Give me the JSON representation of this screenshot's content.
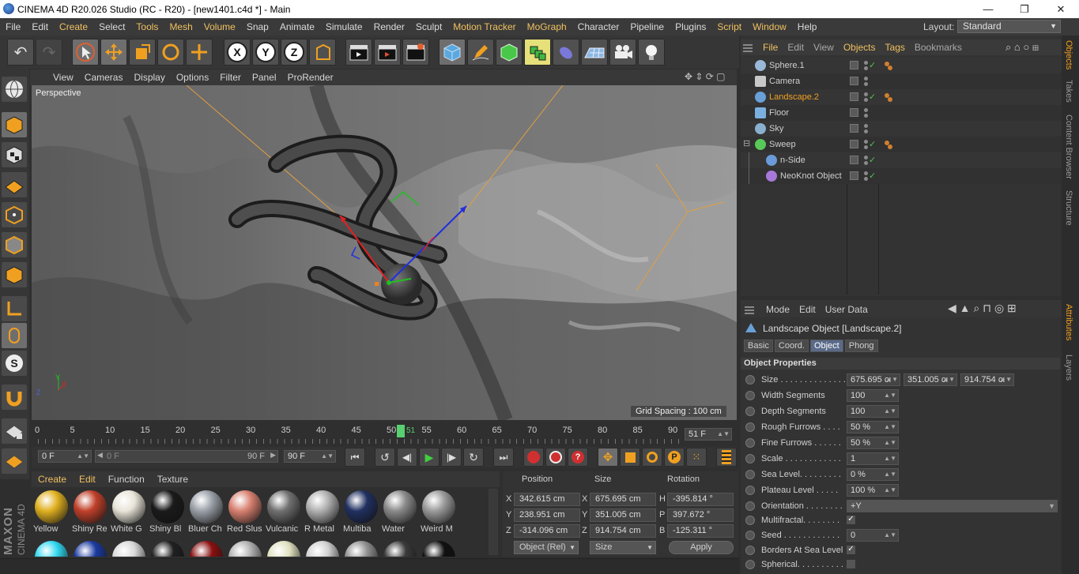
{
  "window": {
    "title": "CINEMA 4D R20.026 Studio (RC - R20) - [new1401.c4d *] - Main",
    "minimize": "—",
    "maximize": "❐",
    "close": "✕"
  },
  "menu": {
    "items": [
      "File",
      "Edit",
      "Create",
      "Select",
      "Tools",
      "Mesh",
      "Volume",
      "Snap",
      "Animate",
      "Simulate",
      "Render",
      "Sculpt",
      "Motion Tracker",
      "MoGraph",
      "Character",
      "Pipeline",
      "Plugins",
      "Script",
      "Window",
      "Help"
    ],
    "layout_label": "Layout:",
    "layout_value": "Standard"
  },
  "toolbar": {
    "axis_x": "X",
    "axis_y": "Y",
    "axis_z": "Z"
  },
  "viewport": {
    "menu": [
      "View",
      "Cameras",
      "Display",
      "Options",
      "Filter",
      "Panel",
      "ProRender"
    ],
    "camera_label": "Perspective",
    "grid_spacing": "Grid Spacing : 100 cm",
    "axis_x": "X",
    "axis_y": "Y",
    "axis_z": "Z"
  },
  "timeline": {
    "ticks": [
      "0",
      "5",
      "10",
      "15",
      "20",
      "25",
      "30",
      "35",
      "40",
      "45",
      "50",
      "55",
      "60",
      "65",
      "70",
      "75",
      "80",
      "85",
      "90"
    ],
    "current_frame_marker": "51",
    "current_frame_field": "51 F",
    "start_field": "0 F",
    "range_start": "0 F",
    "range_end": "90 F",
    "end_field": "90 F"
  },
  "materials": {
    "menu": [
      "Create",
      "Edit",
      "Function",
      "Texture"
    ],
    "row1": [
      {
        "name": "Yellow",
        "color": "#e0b020"
      },
      {
        "name": "Shiny Re",
        "color": "#c0402a"
      },
      {
        "name": "White G",
        "color": "#e8e4d8"
      },
      {
        "name": "Shiny Bl",
        "color": "#1a1a1a"
      },
      {
        "name": "Bluer Ch",
        "color": "#9aa0a8"
      },
      {
        "name": "Red Slus",
        "color": "#d88070"
      },
      {
        "name": "Vulcanic",
        "color": "#707070"
      },
      {
        "name": "R Metal",
        "color": "#b0b0b0"
      },
      {
        "name": "Multiba",
        "color": "#203060"
      },
      {
        "name": "Water",
        "color": "#8a8a8a"
      },
      {
        "name": "Weird M",
        "color": "#9a9a9a"
      }
    ],
    "row2_colors": [
      "#30d8f0",
      "#1a3aa0",
      "#d8d8d8",
      "#202020",
      "#8a1010",
      "#b0b0b0",
      "#e0e0c0",
      "#d0d0d0",
      "#909090",
      "#3a3a3a",
      "#101010"
    ]
  },
  "coords": {
    "headers": {
      "position": "Position",
      "size": "Size",
      "rotation": "Rotation"
    },
    "rows": [
      {
        "pl": "X",
        "pv": "342.615 cm",
        "sl": "X",
        "sv": "675.695 cm",
        "rl": "H",
        "rv": "-395.814 °"
      },
      {
        "pl": "Y",
        "pv": "238.951 cm",
        "sl": "Y",
        "sv": "351.005 cm",
        "rl": "P",
        "rv": "397.672 °"
      },
      {
        "pl": "Z",
        "pv": "-314.096 cm",
        "sl": "Z",
        "sv": "914.754 cm",
        "rl": "B",
        "rv": "-125.311 °"
      }
    ],
    "mode": "Object (Rel)",
    "size_mode": "Size",
    "apply": "Apply"
  },
  "maxon": {
    "brand": "MAXON",
    "product": "CINEMA 4D"
  },
  "objects": {
    "menu": [
      "File",
      "Edit",
      "View",
      "Objects",
      "Tags",
      "Bookmarks"
    ],
    "items": [
      {
        "name": "Sphere.1",
        "color": "#9ab8d8",
        "active": false,
        "tick": true,
        "tag": true,
        "indent": 0
      },
      {
        "name": "Camera",
        "color": "#c8c8c8",
        "active": false,
        "tick": false,
        "tag": false,
        "indent": 0
      },
      {
        "name": "Landscape.2",
        "color": "#6aa0d8",
        "active": true,
        "tick": true,
        "tag": true,
        "indent": 0
      },
      {
        "name": "Floor",
        "color": "#7ab0e0",
        "active": false,
        "tick": false,
        "tag": false,
        "indent": 0
      },
      {
        "name": "Sky",
        "color": "#8ab0d0",
        "active": false,
        "tick": false,
        "tag": false,
        "indent": 0
      },
      {
        "name": "Sweep",
        "color": "#58c858",
        "active": false,
        "tick": true,
        "tag": true,
        "indent": 0
      },
      {
        "name": "n-Side",
        "color": "#6a9ad8",
        "active": false,
        "tick": true,
        "tag": false,
        "indent": 1
      },
      {
        "name": "NeoKnot Object",
        "color": "#a878d8",
        "active": false,
        "tick": true,
        "tag": false,
        "indent": 1
      }
    ]
  },
  "attributes": {
    "menu": [
      "Mode",
      "Edit",
      "User Data"
    ],
    "object_title": "Landscape Object [Landscape.2]",
    "tabs": [
      "Basic",
      "Coord.",
      "Object",
      "Phong"
    ],
    "active_tab": "Object",
    "section": "Object Properties",
    "size_label": "Size . . . . . . . . . . . . . .",
    "size_values": [
      "675.695 cı",
      "351.005 cı",
      "914.754 cı"
    ],
    "props": [
      {
        "label": "Width Segments",
        "value": "100"
      },
      {
        "label": "Depth Segments",
        "value": "100"
      },
      {
        "label": "Rough Furrows . . . .",
        "value": "50 %"
      },
      {
        "label": "Fine Furrows . . . . . .",
        "value": "50 %"
      },
      {
        "label": "Scale . . . . . . . . . . . .",
        "value": "1"
      },
      {
        "label": "Sea Level. . . . . . . . .",
        "value": "0 %"
      },
      {
        "label": "Plateau Level . . . . .",
        "value": "100 %"
      }
    ],
    "orientation_label": "Orientation . . . . . . . .",
    "orientation_value": "+Y",
    "multifractal_label": "Multifractal. . . . . . . .",
    "seed_label": "Seed . . . . . . . . . . . .",
    "seed_value": "0",
    "borders_label": "Borders At Sea Level",
    "spherical_label": "Spherical. . . . . . . . . ."
  },
  "right_tabs": {
    "top": [
      "Objects",
      "Takes",
      "Content Browser",
      "Structure"
    ],
    "bottom": [
      "Attributes",
      "Layers"
    ]
  }
}
